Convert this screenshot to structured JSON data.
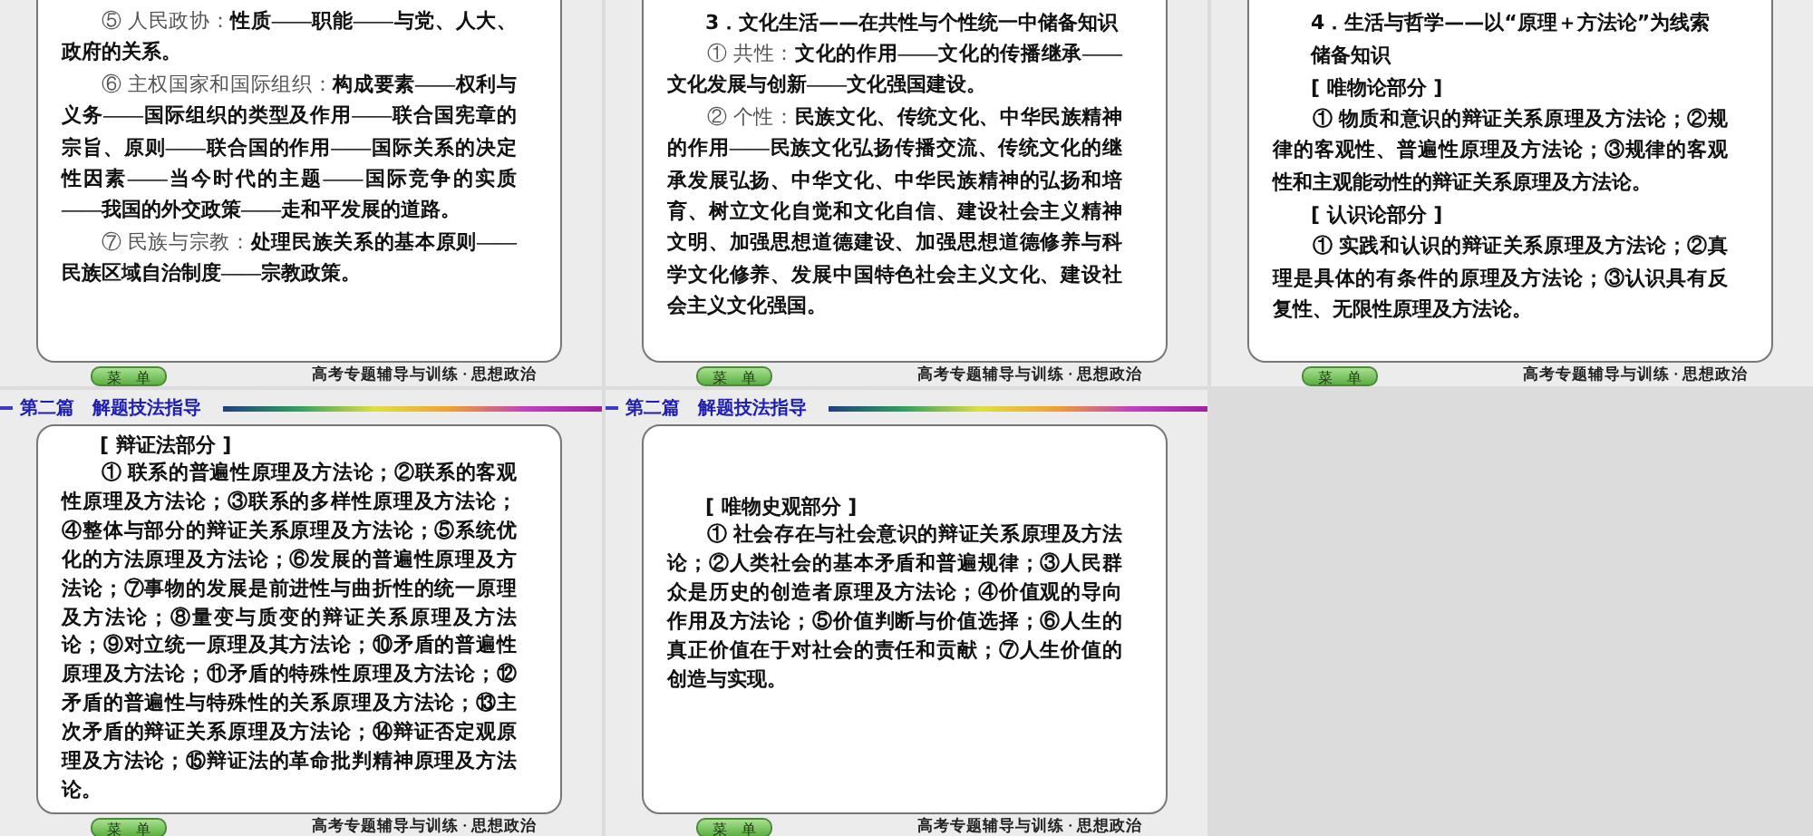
{
  "slides": [
    {
      "paragraphs": [
        {
          "kind": "para",
          "text": "⑤ 人民政协：**性质——职能——与党、人大、政府的关系。**"
        },
        {
          "kind": "para",
          "text": "⑥ 主权国家和国际组织：**构成要素——权利与义务——国际组织的类型及作用——联合国宪章的宗旨、原则——联合国的作用——国际关系的决定性因素——当今时代的主题——国际竞争的实质——我国的外交政策——走和平发展的道路。**"
        },
        {
          "kind": "para",
          "text": "⑦ 民族与宗教：**处理民族关系的基本原则——民族区域自治制度——宗教政策。**"
        }
      ],
      "menu_button": "菜　单",
      "footer": "高考专题辅导与训练 · 思想政治"
    },
    {
      "paragraphs": [
        {
          "kind": "heading",
          "text": "3．文化生活——在共性与个性统一中储备知识"
        },
        {
          "kind": "para",
          "text": "① 共性：**文化的作用——文化的传播继承——文化发展与创新——文化强国建设。**"
        },
        {
          "kind": "para",
          "text": "② 个性：**民族文化、传统文化、中华民族精神的作用——民族文化弘扬传播交流、传统文化的继承发展弘扬、中华文化、中华民族精神的弘扬和培育、树立文化自觉和文化自信、建设社会主义精神文明、加强思想道德建设、加强思想道德修养与科学文化修养、发展中国特色社会主义文化、建设社会主义文化强国。**"
        }
      ],
      "menu_button": "菜　单",
      "footer": "高考专题辅导与训练 · 思想政治"
    },
    {
      "paragraphs": [
        {
          "kind": "heading",
          "text": "4．生活与哲学——以“原理＋方法论”为线索储备知识"
        },
        {
          "kind": "heading",
          "text": "[ 唯物论部分 ]"
        },
        {
          "kind": "para",
          "text": "**① 物质和意识的辩证关系原理及方法论；②规律的客观性、普遍性原理及方法论；③规律的客观性和主观能动性的辩证关系原理及方法论。**"
        },
        {
          "kind": "heading",
          "text": "[ 认识论部分 ]"
        },
        {
          "kind": "para",
          "text": "**① 实践和认识的辩证关系原理及方法论；②真理是具体的有条件的原理及方法论；③认识具有反复性、无限性原理及方法论。**"
        }
      ],
      "menu_button": "菜　单",
      "footer": "高考专题辅导与训练 · 思想政治"
    },
    {
      "header": "第二篇　解题技法指导",
      "paragraphs": [
        {
          "kind": "heading",
          "text": "[ 辩证法部分 ]"
        },
        {
          "kind": "para",
          "text": "**① 联系的普遍性原理及方法论；②联系的客观性原理及方法论；③联系的多样性原理及方法论；④整体与部分的辩证关系原理及方法论；⑤系统优化的方法原理及方法论；⑥发展的普遍性原理及方法论；⑦事物的发展是前进性与曲折性的统一原理及方法论；⑧量变与质变的辩证关系原理及方法论；⑨对立统一原理及其方法论；⑩矛盾的普遍性原理及方法论；⑪矛盾的特殊性原理及方法论；⑫矛盾的普遍性与特殊性的关系原理及方法论；⑬主次矛盾的辩证关系原理及方法论；⑭辩证否定观原理及方法论；⑮辩证法的革命批判精神原理及方法论。**"
        }
      ],
      "menu_button": "菜　单",
      "footer": "高考专题辅导与训练 · 思想政治"
    },
    {
      "header": "第二篇　解题技法指导",
      "paragraphs": [
        {
          "kind": "heading",
          "text": "[ 唯物史观部分 ]"
        },
        {
          "kind": "para",
          "text": "**① 社会存在与社会意识的辩证关系原理及方法论；②人类社会的基本矛盾和普遍规律；③人民群众是历史的创造者原理及方法论；④价值观的导向作用及方法论；⑤价值判断与价值选择；⑥人生的真正价值在于对社会的责任和贡献；⑦人生价值的创造与实现。**"
        }
      ],
      "menu_button": "菜　单",
      "footer": "高考专题辅导与训练 · 思想政治"
    }
  ]
}
